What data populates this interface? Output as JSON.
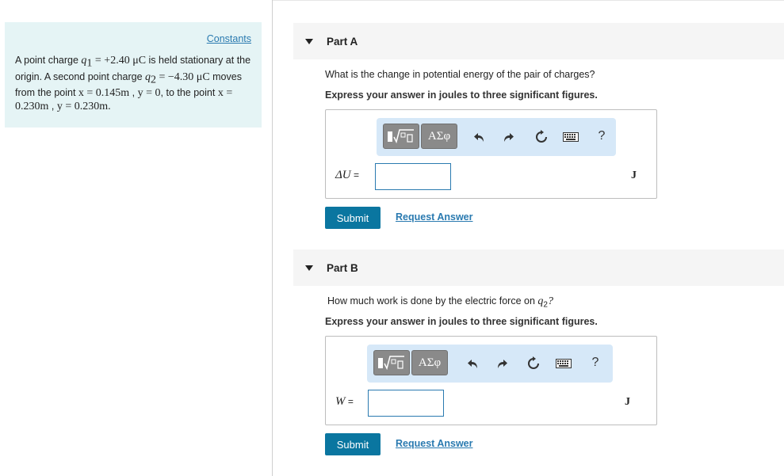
{
  "problem": {
    "constants_link": "Constants",
    "text": {
      "p1": "A point charge ",
      "q1_var": "q",
      "q1_sub": "1",
      "q1_val": " = +2.40 μC",
      "p2": " is held stationary at the origin. A second point charge ",
      "q2_var": "q",
      "q2_sub": "2",
      "q2_val": " = −4.30 μC",
      "p3": " moves from the point ",
      "x1": "x = 0.145m",
      "sep1": " , ",
      "y1": "y = 0",
      "p4": ", to the point ",
      "x2": "x = 0.230m",
      "sep2": " , ",
      "y2": "y = 0.230m",
      "end": "."
    }
  },
  "parts": [
    {
      "title": "Part A",
      "question": "What is the change in potential energy of the pair of charges?",
      "instruction": "Express your answer in joules to three significant figures.",
      "toolbar": {
        "template_label": "template-buttons",
        "greek_label": "ΑΣφ",
        "help_label": "?"
      },
      "variable": "ΔU",
      "equals": " = ",
      "input_value": "",
      "unit": "J",
      "submit_label": "Submit",
      "request_label": "Request Answer"
    },
    {
      "title": "Part B",
      "question_pre": "How much work is done by the electric force on ",
      "question_var": "q",
      "question_sub": "2",
      "question_post": "?",
      "instruction": "Express your answer in joules to three significant figures.",
      "toolbar": {
        "template_label": "template-buttons",
        "greek_label": "ΑΣφ",
        "help_label": "?"
      },
      "variable": "W",
      "equals": " = ",
      "input_value": "",
      "unit": "J",
      "submit_label": "Submit",
      "request_label": "Request Answer"
    }
  ],
  "icons": [
    "caret-down-icon",
    "sqrt-template-icon",
    "undo-icon",
    "redo-icon",
    "reset-icon",
    "keyboard-icon",
    "help-icon"
  ],
  "colors": {
    "panel_bg": "#e5f4f5",
    "toolbar_bg": "#d6e8f8",
    "submit_bg": "#0a76a0",
    "link": "#2a7ab0"
  }
}
